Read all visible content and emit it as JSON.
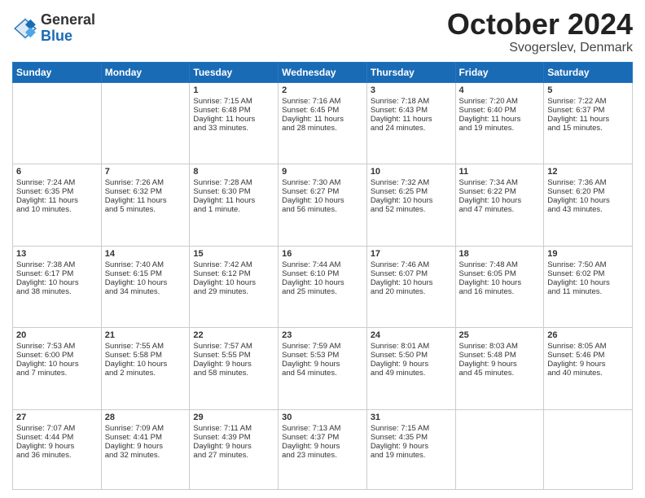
{
  "logo": {
    "general": "General",
    "blue": "Blue"
  },
  "header": {
    "month": "October 2024",
    "location": "Svogerslev, Denmark"
  },
  "days": [
    "Sunday",
    "Monday",
    "Tuesday",
    "Wednesday",
    "Thursday",
    "Friday",
    "Saturday"
  ],
  "weeks": [
    [
      {
        "day": "",
        "info": ""
      },
      {
        "day": "",
        "info": ""
      },
      {
        "day": "1",
        "info": "Sunrise: 7:15 AM\nSunset: 6:48 PM\nDaylight: 11 hours\nand 33 minutes."
      },
      {
        "day": "2",
        "info": "Sunrise: 7:16 AM\nSunset: 6:45 PM\nDaylight: 11 hours\nand 28 minutes."
      },
      {
        "day": "3",
        "info": "Sunrise: 7:18 AM\nSunset: 6:43 PM\nDaylight: 11 hours\nand 24 minutes."
      },
      {
        "day": "4",
        "info": "Sunrise: 7:20 AM\nSunset: 6:40 PM\nDaylight: 11 hours\nand 19 minutes."
      },
      {
        "day": "5",
        "info": "Sunrise: 7:22 AM\nSunset: 6:37 PM\nDaylight: 11 hours\nand 15 minutes."
      }
    ],
    [
      {
        "day": "6",
        "info": "Sunrise: 7:24 AM\nSunset: 6:35 PM\nDaylight: 11 hours\nand 10 minutes."
      },
      {
        "day": "7",
        "info": "Sunrise: 7:26 AM\nSunset: 6:32 PM\nDaylight: 11 hours\nand 5 minutes."
      },
      {
        "day": "8",
        "info": "Sunrise: 7:28 AM\nSunset: 6:30 PM\nDaylight: 11 hours\nand 1 minute."
      },
      {
        "day": "9",
        "info": "Sunrise: 7:30 AM\nSunset: 6:27 PM\nDaylight: 10 hours\nand 56 minutes."
      },
      {
        "day": "10",
        "info": "Sunrise: 7:32 AM\nSunset: 6:25 PM\nDaylight: 10 hours\nand 52 minutes."
      },
      {
        "day": "11",
        "info": "Sunrise: 7:34 AM\nSunset: 6:22 PM\nDaylight: 10 hours\nand 47 minutes."
      },
      {
        "day": "12",
        "info": "Sunrise: 7:36 AM\nSunset: 6:20 PM\nDaylight: 10 hours\nand 43 minutes."
      }
    ],
    [
      {
        "day": "13",
        "info": "Sunrise: 7:38 AM\nSunset: 6:17 PM\nDaylight: 10 hours\nand 38 minutes."
      },
      {
        "day": "14",
        "info": "Sunrise: 7:40 AM\nSunset: 6:15 PM\nDaylight: 10 hours\nand 34 minutes."
      },
      {
        "day": "15",
        "info": "Sunrise: 7:42 AM\nSunset: 6:12 PM\nDaylight: 10 hours\nand 29 minutes."
      },
      {
        "day": "16",
        "info": "Sunrise: 7:44 AM\nSunset: 6:10 PM\nDaylight: 10 hours\nand 25 minutes."
      },
      {
        "day": "17",
        "info": "Sunrise: 7:46 AM\nSunset: 6:07 PM\nDaylight: 10 hours\nand 20 minutes."
      },
      {
        "day": "18",
        "info": "Sunrise: 7:48 AM\nSunset: 6:05 PM\nDaylight: 10 hours\nand 16 minutes."
      },
      {
        "day": "19",
        "info": "Sunrise: 7:50 AM\nSunset: 6:02 PM\nDaylight: 10 hours\nand 11 minutes."
      }
    ],
    [
      {
        "day": "20",
        "info": "Sunrise: 7:53 AM\nSunset: 6:00 PM\nDaylight: 10 hours\nand 7 minutes."
      },
      {
        "day": "21",
        "info": "Sunrise: 7:55 AM\nSunset: 5:58 PM\nDaylight: 10 hours\nand 2 minutes."
      },
      {
        "day": "22",
        "info": "Sunrise: 7:57 AM\nSunset: 5:55 PM\nDaylight: 9 hours\nand 58 minutes."
      },
      {
        "day": "23",
        "info": "Sunrise: 7:59 AM\nSunset: 5:53 PM\nDaylight: 9 hours\nand 54 minutes."
      },
      {
        "day": "24",
        "info": "Sunrise: 8:01 AM\nSunset: 5:50 PM\nDaylight: 9 hours\nand 49 minutes."
      },
      {
        "day": "25",
        "info": "Sunrise: 8:03 AM\nSunset: 5:48 PM\nDaylight: 9 hours\nand 45 minutes."
      },
      {
        "day": "26",
        "info": "Sunrise: 8:05 AM\nSunset: 5:46 PM\nDaylight: 9 hours\nand 40 minutes."
      }
    ],
    [
      {
        "day": "27",
        "info": "Sunrise: 7:07 AM\nSunset: 4:44 PM\nDaylight: 9 hours\nand 36 minutes."
      },
      {
        "day": "28",
        "info": "Sunrise: 7:09 AM\nSunset: 4:41 PM\nDaylight: 9 hours\nand 32 minutes."
      },
      {
        "day": "29",
        "info": "Sunrise: 7:11 AM\nSunset: 4:39 PM\nDaylight: 9 hours\nand 27 minutes."
      },
      {
        "day": "30",
        "info": "Sunrise: 7:13 AM\nSunset: 4:37 PM\nDaylight: 9 hours\nand 23 minutes."
      },
      {
        "day": "31",
        "info": "Sunrise: 7:15 AM\nSunset: 4:35 PM\nDaylight: 9 hours\nand 19 minutes."
      },
      {
        "day": "",
        "info": ""
      },
      {
        "day": "",
        "info": ""
      }
    ]
  ]
}
